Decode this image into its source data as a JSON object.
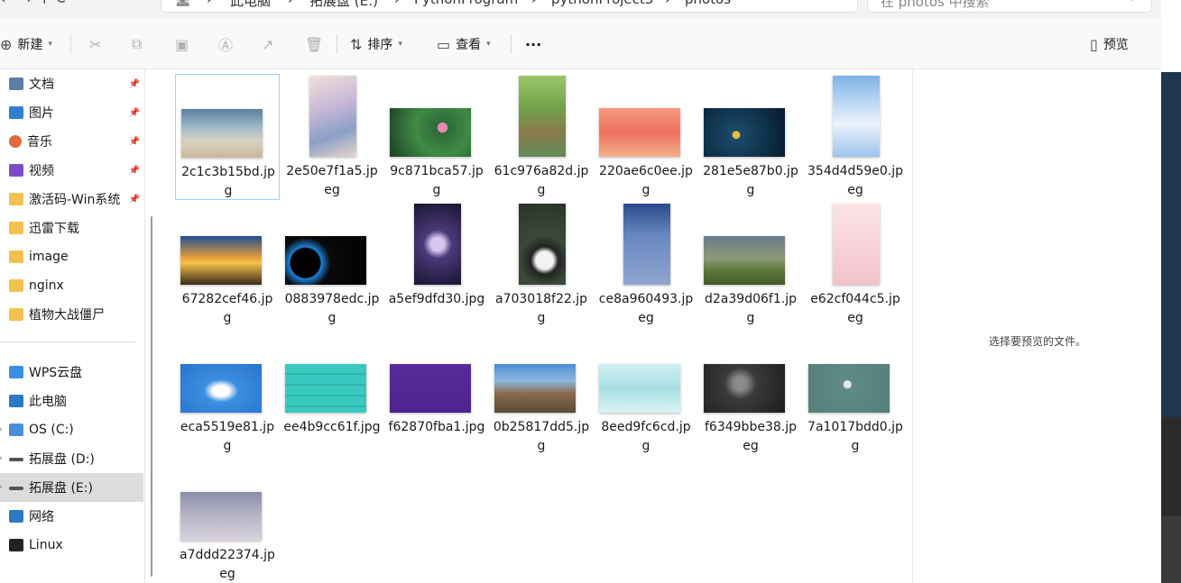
{
  "address_bar": {
    "nav_glyphs": "← → ↑ ⟳",
    "path": [
      "此电脑",
      "拓展盘 (E:)",
      "PythonProgram",
      "pythonProject3",
      "photos"
    ],
    "search_placeholder": "在 photos 中搜索"
  },
  "toolbar": {
    "new_label": "新建",
    "sort_label": "排序",
    "view_label": "查看",
    "more_label": "···",
    "preview_label": "预览"
  },
  "sidebar": {
    "items": [
      {
        "label": "文档",
        "icon": "document-icon",
        "color": "#5b7fa6",
        "pinned": true
      },
      {
        "label": "图片",
        "icon": "pictures-icon",
        "color": "#2f7fd0",
        "pinned": true
      },
      {
        "label": "音乐",
        "icon": "music-icon",
        "color": "#e06a3c",
        "pinned": true
      },
      {
        "label": "视频",
        "icon": "video-icon",
        "color": "#7c4dc9",
        "pinned": true
      },
      {
        "label": "激活码-Win系统",
        "icon": "folder-icon",
        "color": "#f2c14e",
        "pinned": true
      },
      {
        "label": "迅雷下载",
        "icon": "folder-icon",
        "color": "#f2c14e",
        "pinned": false
      },
      {
        "label": "image",
        "icon": "folder-icon",
        "color": "#f2c14e",
        "pinned": false
      },
      {
        "label": "nginx",
        "icon": "folder-icon",
        "color": "#f2c14e",
        "pinned": false
      },
      {
        "label": "植物大战僵尸",
        "icon": "folder-icon",
        "color": "#f2c14e",
        "pinned": false
      },
      {
        "label": "WPS云盘",
        "icon": "cloud-icon",
        "color": "#3a8ee6",
        "pinned": false
      },
      {
        "label": "此电脑",
        "icon": "computer-icon",
        "color": "#2b79c2",
        "pinned": false
      },
      {
        "label": "OS (C:)",
        "icon": "windows-drive-icon",
        "color": "#4a90d9",
        "pinned": false
      },
      {
        "label": "拓展盘 (D:)",
        "icon": "drive-icon",
        "color": "#555555",
        "pinned": false
      },
      {
        "label": "拓展盘 (E:)",
        "icon": "drive-icon",
        "color": "#555555",
        "pinned": false
      },
      {
        "label": "网络",
        "icon": "network-icon",
        "color": "#2b79c2",
        "pinned": false
      },
      {
        "label": "Linux",
        "icon": "penguin-icon",
        "color": "#222222",
        "pinned": false
      }
    ]
  },
  "files": [
    {
      "name": "2c1c3b15bd.jpg",
      "bg": "linear-gradient(180deg,#5c7fa0 0%,#9ab6c8 35%,#d9d2c2 65%,#c9b79b 100%)",
      "orient": "landscape"
    },
    {
      "name": "2e50e7f1a5.jpeg",
      "bg": "linear-gradient(160deg,#f0e2d8 0%,#c7b6d6 40%,#8a9fc8 70%,#e8d6c8 100%)",
      "orient": "portrait"
    },
    {
      "name": "9c871bca57.jpg",
      "bg": "radial-gradient(circle at 65% 40%,#e58ab0 0 8%,#2f6a3a 9%,#3f8b45 45%,#1e3f24 100%)",
      "orient": "landscape"
    },
    {
      "name": "61c976a82d.jpg",
      "bg": "linear-gradient(180deg,#9cc56a 0%,#6fa24a 40%,#8a7a4a 70%,#5f8a5a 100%)",
      "orient": "portrait"
    },
    {
      "name": "220ae6c0ee.jpg",
      "bg": "linear-gradient(180deg,#f59a7e 0%,#ef7060 50%,#f3b08a 100%)",
      "orient": "landscape"
    },
    {
      "name": "281e5e87b0.jpg",
      "bg": "radial-gradient(circle at 40% 55%,#e6c23a 0 6%,#1a4a6a 8%,#0f2f48 60%,#08192a 100%)",
      "orient": "landscape"
    },
    {
      "name": "354d4d59e0.jpeg",
      "bg": "linear-gradient(180deg,#7fb2e6 0%,#c8dff5 40%,#eaf2fb 60%,#9cc4ec 100%)",
      "orient": "portrait"
    },
    {
      "name": "67282cef46.jpg",
      "bg": "linear-gradient(180deg,#1f4f8f 0%,#e9a03a 45%,#f6c24a 55%,#3a2a18 100%)",
      "orient": "landscape"
    },
    {
      "name": "0883978edc.jpg",
      "bg": "radial-gradient(circle at 25% 55%,#000 0 22%,#1a7fd6 24%,#0a0a0a 38%,#000 100%)",
      "orient": "landscape"
    },
    {
      "name": "a5ef9dfd30.jpg",
      "bg": "radial-gradient(circle at 50% 50%,#d8c8f0 0 14%,#4a3a7a 30%,#1a1530 100%)",
      "orient": "portrait"
    },
    {
      "name": "a703018f22.jpg",
      "bg": "radial-gradient(circle at 55% 70%,#f2f2f2 0 14%,#222 22%,#3a4a3a 40%,#2a332a 100%)",
      "orient": "portrait"
    },
    {
      "name": "ce8a960493.jpeg",
      "bg": "linear-gradient(180deg,#2a4a8a 0%,#6a88c0 40%,#8fa6cf 100%)",
      "orient": "portrait"
    },
    {
      "name": "d2a39d06f1.jpg",
      "bg": "linear-gradient(180deg,#6a7a8a 0%,#8a9a7a 45%,#5e7a3a 70%,#3f5a2a 100%)",
      "orient": "landscape"
    },
    {
      "name": "e62cf044c5.jpeg",
      "bg": "linear-gradient(180deg,#fbe3e6 0%,#f6cfd6 60%,#f2c3cb 100%)",
      "orient": "portrait"
    },
    {
      "name": "eca5519e81.jpg",
      "bg": "radial-gradient(ellipse at 50% 55%,#ffffff 0 14%,#3b8ee0 30%,#2a74cc 100%)",
      "orient": "landscape"
    },
    {
      "name": "ee4b9cc61f.jpg",
      "bg": "repeating-linear-gradient(180deg,#37c9c0 0 10px,#2fb4ab 10px 12px)",
      "orient": "landscape"
    },
    {
      "name": "f62870fba1.jpg",
      "bg": "linear-gradient(180deg,#5a2a9a 0%,#4e2390 100%)",
      "orient": "landscape"
    },
    {
      "name": "0b25817dd5.jpg",
      "bg": "linear-gradient(180deg,#4a8fd6 0%,#8fb8e0 35%,#8a6a4a 60%,#5a4a3a 100%)",
      "orient": "landscape"
    },
    {
      "name": "8eed9fc6cd.jpg",
      "bg": "linear-gradient(180deg,#cfeef0 0%,#a8dfe3 50%,#d9f1f2 100%)",
      "orient": "landscape"
    },
    {
      "name": "f6349bbe38.jpeg",
      "bg": "radial-gradient(circle at 45% 40%,#8a8a8a 0 12%,#3a3a3a 30%,#1e1e1e 100%)",
      "orient": "landscape"
    },
    {
      "name": "7a1017bdd0.jpg",
      "bg": "radial-gradient(circle at 48% 42%,#dfeaf0 0 7%,#5f8a86 9%,#567e7a 100%)",
      "orient": "landscape"
    },
    {
      "name": "a7ddd22374.jpeg",
      "bg": "linear-gradient(180deg,#8a8ea8 0%,#b8b6c8 50%,#d8d2dc 100%)",
      "orient": "landscape"
    }
  ],
  "preview_pane": {
    "message": "选择要预览的文件。"
  }
}
